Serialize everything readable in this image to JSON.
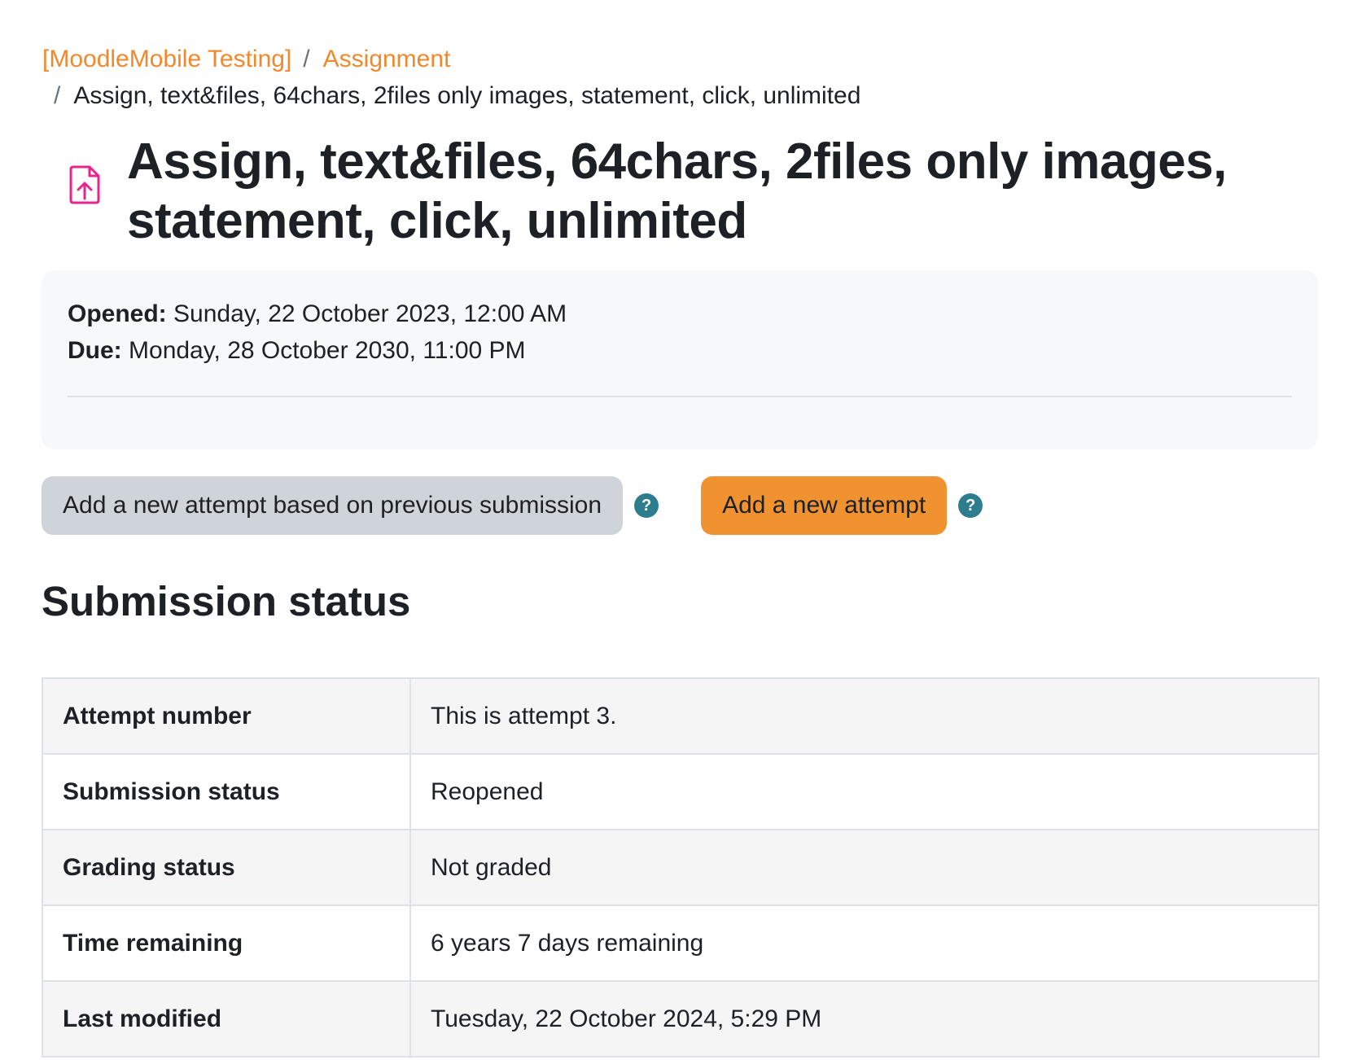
{
  "breadcrumb": {
    "items": [
      "[MoodleMobile Testing]",
      "Assignment"
    ],
    "separator": "/",
    "current": "Assign, text&files, 64chars, 2files only images, statement, click, unlimited"
  },
  "header": {
    "icon": "assignment-upload-icon",
    "icon_color": "#e8258c",
    "title": "Assign, text&files, 64chars, 2files only images, statement, click, unlimited"
  },
  "dates": {
    "opened_label": "Opened:",
    "opened_value": "Sunday, 22 October 2023, 12:00 AM",
    "due_label": "Due:",
    "due_value": "Monday, 28 October 2030, 11:00 PM"
  },
  "actions": {
    "previous_attempt_label": "Add a new attempt based on previous submission",
    "new_attempt_label": "Add a new attempt",
    "help_glyph": "?",
    "primary_color": "#f0922f",
    "secondary_color": "#ced4da",
    "help_color": "#2d7d8f"
  },
  "submission": {
    "heading": "Submission status",
    "rows": [
      {
        "label": "Attempt number",
        "value": "This is attempt 3."
      },
      {
        "label": "Submission status",
        "value": "Reopened"
      },
      {
        "label": "Grading status",
        "value": "Not graded"
      },
      {
        "label": "Time remaining",
        "value": "6 years 7 days remaining"
      },
      {
        "label": "Last modified",
        "value": "Tuesday, 22 October 2024, 5:29 PM"
      }
    ]
  }
}
